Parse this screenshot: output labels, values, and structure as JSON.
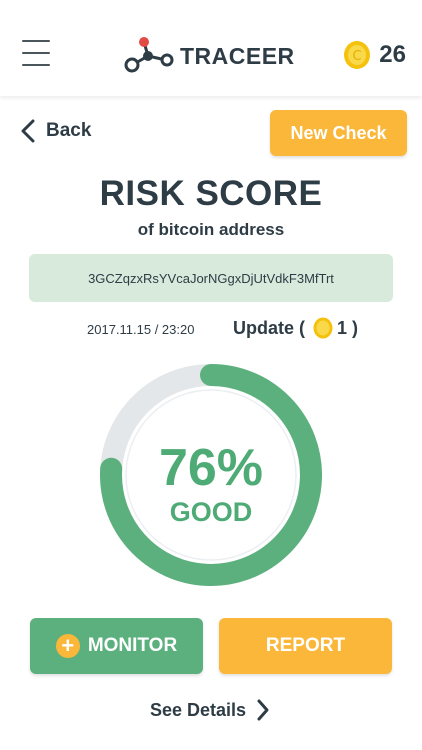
{
  "header": {
    "brand": "TRACEER",
    "coin_balance": "26",
    "icons": {
      "menu": "hamburger-menu-icon",
      "logo": "node-graph-logo-icon",
      "coin": "coin-icon"
    }
  },
  "nav": {
    "back_label": "Back",
    "new_check_label": "New Check"
  },
  "risk": {
    "title": "RISK SCORE",
    "subtitle": "of bitcoin address",
    "address": "3GCZqzxRsYVcaJorNGgxDjUtVdkF3MfTrt",
    "timestamp": "2017.11.15 / 23:20",
    "update_label": "Update (",
    "update_cost": "1 )",
    "score_text": "76%",
    "score_value": 0.76,
    "status": "GOOD"
  },
  "actions": {
    "monitor_plus": "+",
    "monitor_label": "MONITOR",
    "report_label": "REPORT",
    "details_label": "See Details"
  },
  "colors": {
    "accent_orange": "#fbb73a",
    "accent_green": "#5cb07e",
    "score_green": "#4fab76",
    "address_bg": "#d7eadc",
    "text_dark": "#2e3c46",
    "track_gray": "#e3e7e9"
  }
}
